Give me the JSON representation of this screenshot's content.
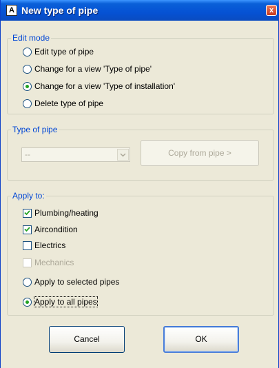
{
  "window": {
    "title": "New type of pipe",
    "icon_label": "A",
    "close_symbol": "x"
  },
  "edit_mode": {
    "legend": "Edit mode",
    "options": [
      {
        "label": "Edit type of pipe",
        "selected": false
      },
      {
        "label": "Change for a view 'Type of pipe'",
        "selected": false
      },
      {
        "label": "Change for a view 'Type of installation'",
        "selected": true
      },
      {
        "label": "Delete type of pipe",
        "selected": false
      }
    ]
  },
  "type_of_pipe": {
    "legend": "Type of pipe",
    "combo_value": "--",
    "copy_button": "Copy from pipe >"
  },
  "apply_to": {
    "legend": "Apply to:",
    "checkboxes": [
      {
        "label": "Plumbing/heating",
        "checked": true,
        "enabled": true
      },
      {
        "label": "Aircondition",
        "checked": true,
        "enabled": true
      },
      {
        "label": "Electrics",
        "checked": false,
        "enabled": true
      },
      {
        "label": "Mechanics",
        "checked": false,
        "enabled": false
      }
    ],
    "radios": [
      {
        "label": "Apply to selected pipes",
        "selected": false
      },
      {
        "label": "Apply to all pipes",
        "selected": true
      }
    ]
  },
  "buttons": {
    "cancel": "Cancel",
    "ok": "OK"
  },
  "colors": {
    "title_bar": "#0552d4",
    "legend_text": "#0046d5",
    "dialog_bg": "#ece9d8",
    "radio_dot": "#21a121"
  }
}
